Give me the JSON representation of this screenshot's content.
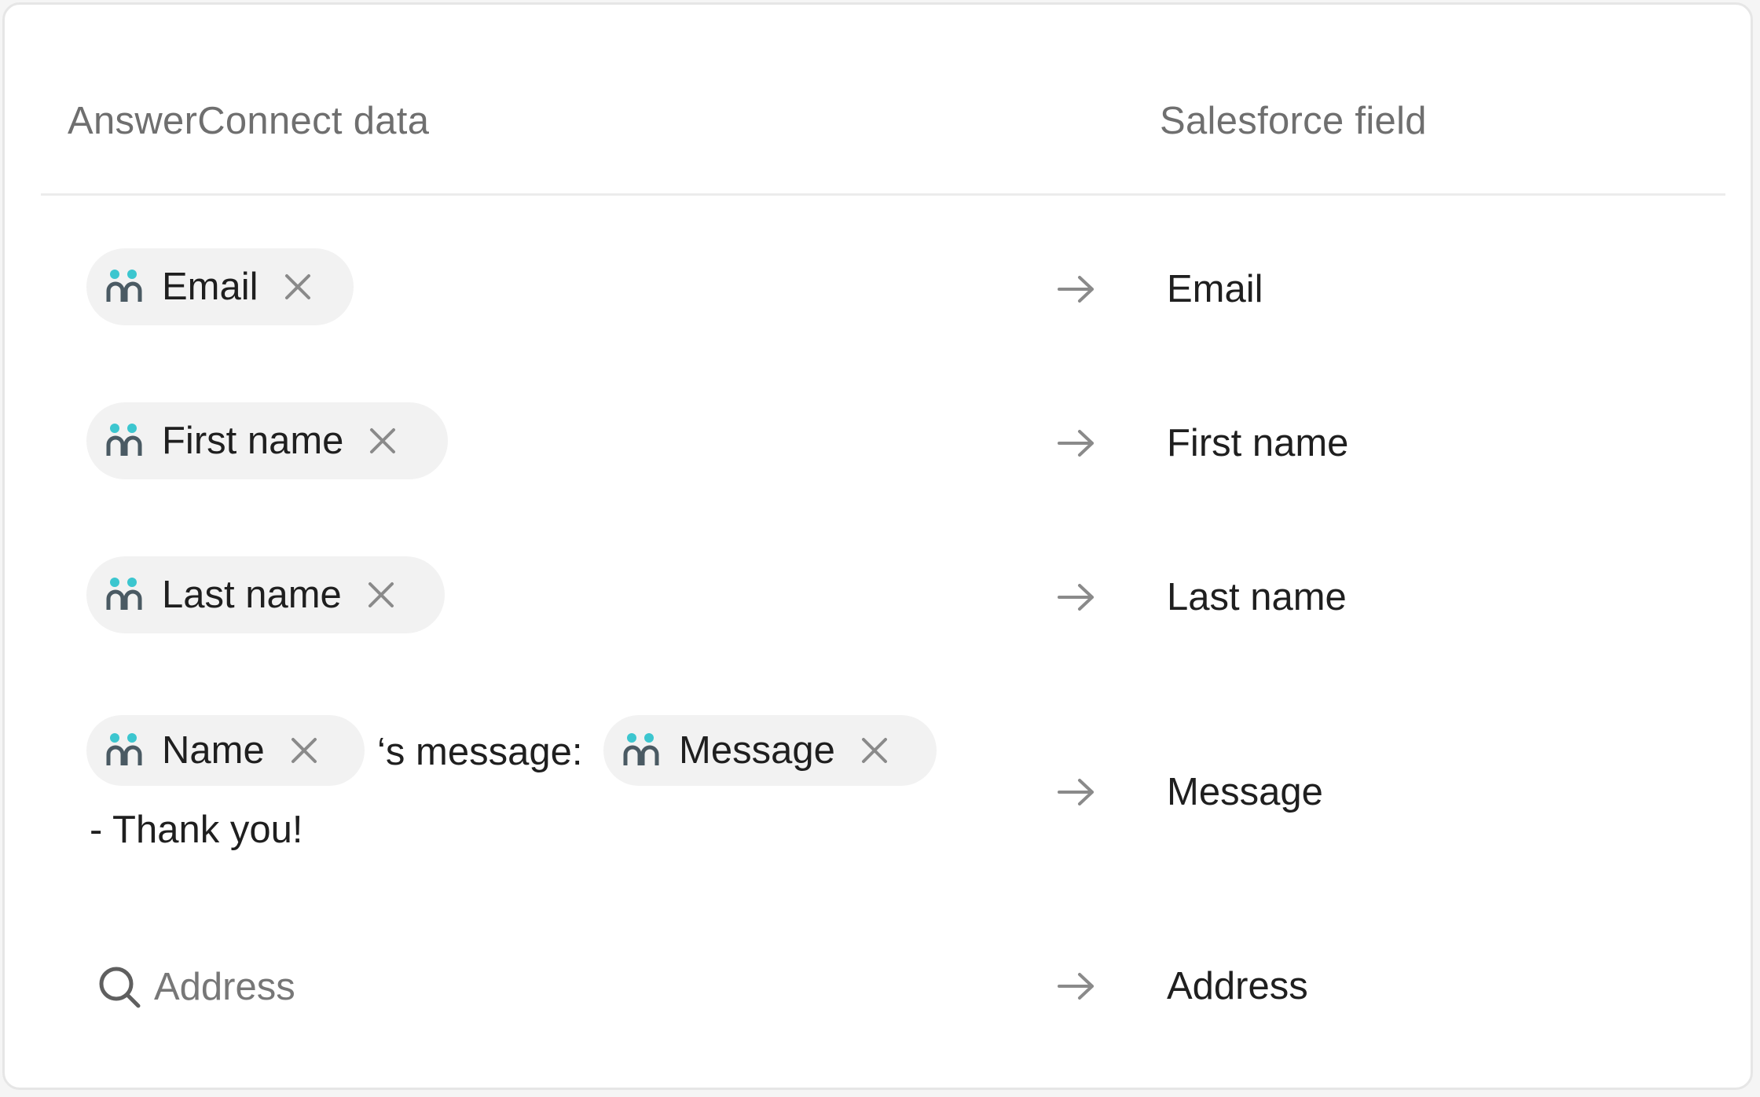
{
  "header": {
    "left_label": "AnswerConnect data",
    "right_label": "Salesforce field"
  },
  "mappings": [
    {
      "pill_label": "Email",
      "field": "Email"
    },
    {
      "pill_label": "First name",
      "field": "First name"
    },
    {
      "pill_label": "Last name",
      "field": "Last name"
    },
    {
      "pill_label": "Name",
      "connector_text": "‘s message:",
      "pill2_label": "Message",
      "suffix_text": "- Thank you!",
      "field": "Message"
    }
  ],
  "search": {
    "placeholder": "Address",
    "field": "Address"
  },
  "icons": {
    "contact": "contact-pair-icon",
    "remove": "close-icon",
    "arrow": "arrow-right-icon",
    "search": "search-icon"
  },
  "colors": {
    "accent": "#3cc6cf",
    "icon_dark": "#4a5a63",
    "pill_bg": "#f2f2f2"
  }
}
